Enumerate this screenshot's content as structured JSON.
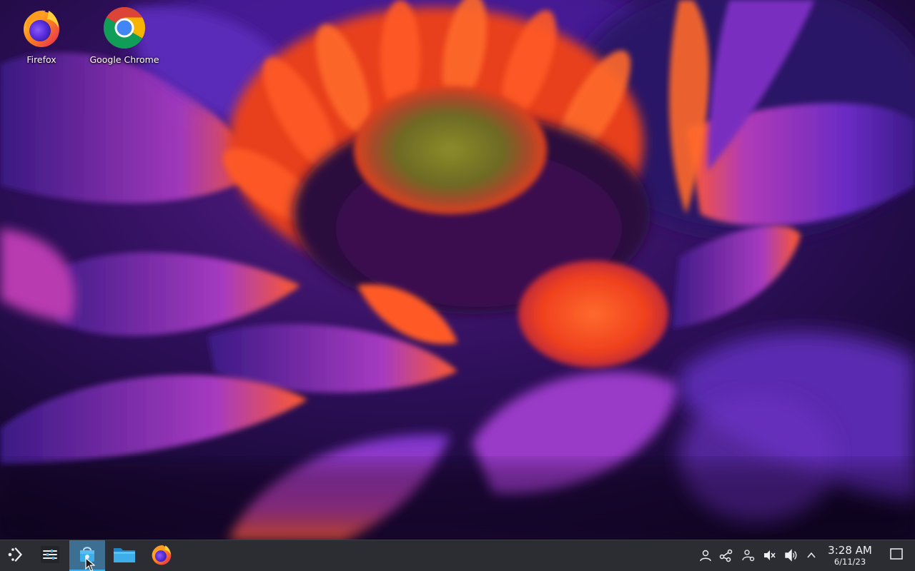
{
  "desktop": {
    "icons": [
      {
        "label": "Firefox",
        "icon": "firefox-icon"
      },
      {
        "label": "Google Chrome",
        "icon": "chrome-icon"
      }
    ]
  },
  "taskbar": {
    "launchers": [
      {
        "name": "application-launcher",
        "icon": "kde-launcher-icon"
      },
      {
        "name": "system-settings",
        "icon": "sliders-icon"
      },
      {
        "name": "discover",
        "icon": "shopping-bag-icon",
        "active": true
      },
      {
        "name": "dolphin",
        "icon": "folder-icon"
      },
      {
        "name": "firefox",
        "icon": "firefox-icon"
      }
    ],
    "tray": [
      {
        "name": "user",
        "icon": "user-icon"
      },
      {
        "name": "kde-connect",
        "icon": "kde-connect-icon"
      },
      {
        "name": "network",
        "icon": "network-user-icon"
      },
      {
        "name": "microphone-muted",
        "icon": "mic-muted-icon"
      },
      {
        "name": "volume",
        "icon": "speaker-icon"
      },
      {
        "name": "expand-tray",
        "icon": "chevron-up-icon"
      }
    ],
    "clock": {
      "time": "3:28 AM",
      "date": "6/11/23"
    },
    "show_desktop": {
      "icon": "show-desktop-icon"
    }
  },
  "colors": {
    "taskbar_bg": "#2b2d33",
    "active_task": "#3d6f93",
    "accent": "#3daee9"
  }
}
